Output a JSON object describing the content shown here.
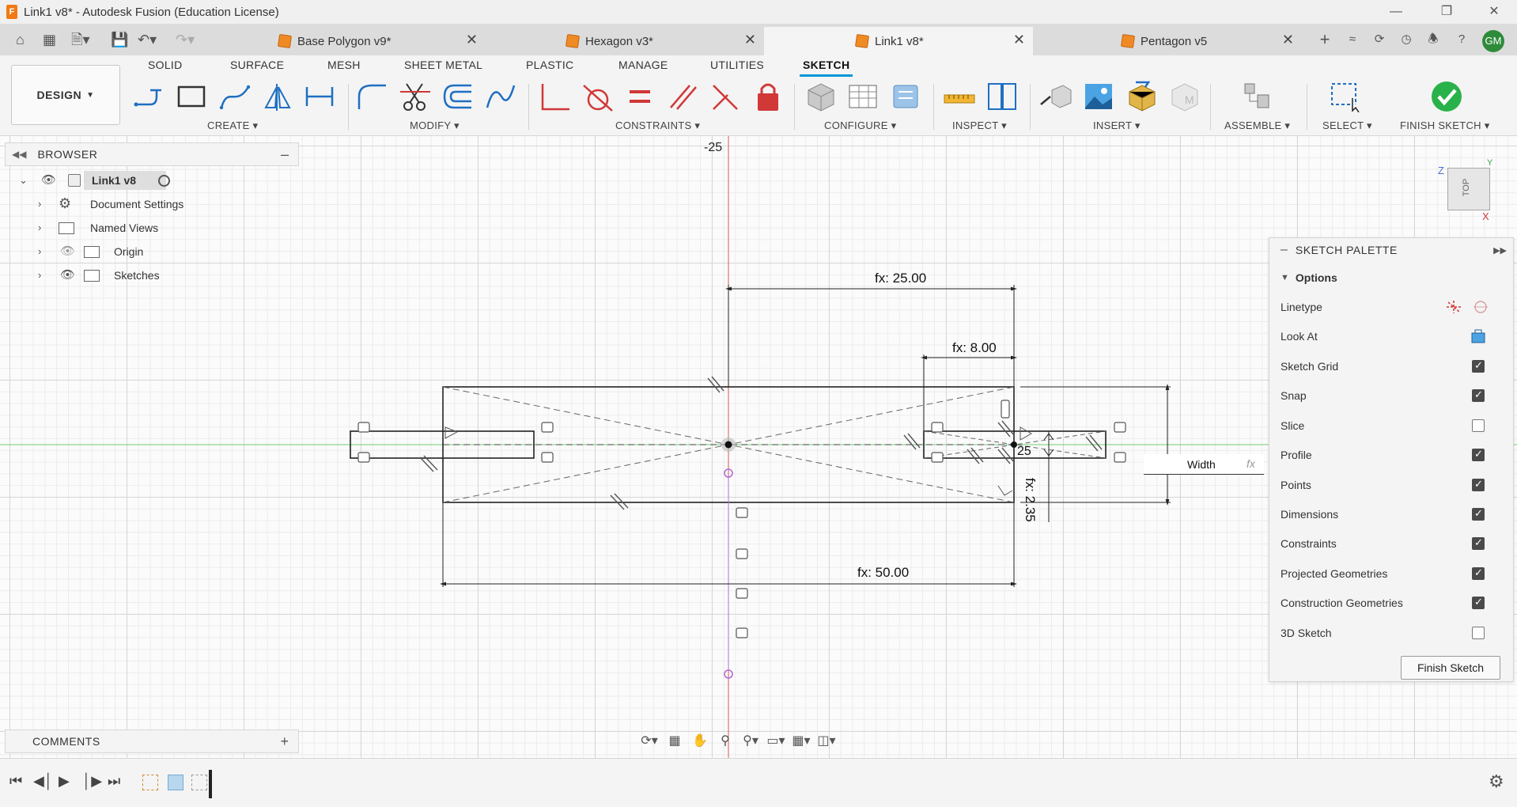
{
  "window": {
    "title": "Link1 v8* - Autodesk Fusion (Education License)"
  },
  "tabs": [
    {
      "label": "Base Polygon v9*"
    },
    {
      "label": "Hexagon v3*"
    },
    {
      "label": "Link1 v8*"
    },
    {
      "label": "Pentagon v5"
    }
  ],
  "user": {
    "initials": "GM"
  },
  "workspace": {
    "label": "DESIGN"
  },
  "ribbon_tabs": [
    "SOLID",
    "SURFACE",
    "MESH",
    "SHEET METAL",
    "PLASTIC",
    "MANAGE",
    "UTILITIES",
    "SKETCH"
  ],
  "ribbon_groups": [
    "CREATE",
    "MODIFY",
    "CONSTRAINTS",
    "CONFIGURE",
    "INSPECT",
    "INSERT",
    "ASSEMBLE",
    "SELECT",
    "FINISH SKETCH"
  ],
  "browser": {
    "title": "BROWSER",
    "root": "Link1 v8",
    "items": [
      "Document Settings",
      "Named Views",
      "Origin",
      "Sketches"
    ]
  },
  "comments": {
    "title": "COMMENTS"
  },
  "sketch": {
    "top_label": "-25",
    "dims": {
      "d25": "fx: 25.00",
      "d8": "fx: 8.00",
      "d50": "fx: 50.00",
      "d235": "fx: 2.35",
      "partial": "25"
    }
  },
  "palette": {
    "title": "SKETCH PALETTE",
    "section": "Options",
    "linetype": "Linetype",
    "look_at": "Look At",
    "options": [
      {
        "label": "Sketch Grid",
        "checked": true
      },
      {
        "label": "Snap",
        "checked": true
      },
      {
        "label": "Slice",
        "checked": false
      },
      {
        "label": "Profile",
        "checked": true
      },
      {
        "label": "Points",
        "checked": true
      },
      {
        "label": "Dimensions",
        "checked": true
      },
      {
        "label": "Constraints",
        "checked": true
      },
      {
        "label": "Projected Geometries",
        "checked": true
      },
      {
        "label": "Construction Geometries",
        "checked": true
      },
      {
        "label": "3D Sketch",
        "checked": false
      }
    ],
    "finish_label": "Finish Sketch"
  },
  "dim_input": {
    "value": "Width",
    "fx": "fx"
  },
  "viewcube": {
    "face": "TOP",
    "axis_z": "Z",
    "axis_x": "X",
    "axis_y": "Y"
  },
  "colors": {
    "accent": "#0696d7",
    "finish_green": "#2ab24a",
    "constraint_red": "#d13838",
    "orange": "#f08a24"
  }
}
